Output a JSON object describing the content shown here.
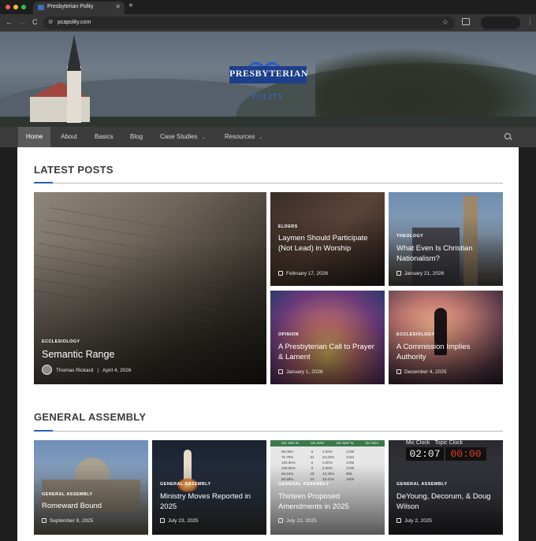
{
  "browser": {
    "tab_title": "Presbyterian Polity",
    "tab_close": "✕",
    "new_tab": "+",
    "url": "pcapolity.com",
    "back": "←",
    "forward": "→",
    "reload": "C",
    "site_info": "⚙",
    "star": "☆",
    "menu": "⋮"
  },
  "logo": {
    "line1": "PRESBYTERIAN",
    "line2": "POLITY"
  },
  "nav": {
    "items": [
      {
        "label": "Home"
      },
      {
        "label": "About"
      },
      {
        "label": "Basics"
      },
      {
        "label": "Blog"
      },
      {
        "label": "Case Studies"
      },
      {
        "label": "Resources"
      }
    ],
    "caret": "⌄"
  },
  "latest": {
    "title": "LATEST POSTS",
    "feature": {
      "category": "ECCLESIOLOGY",
      "title": "Semantic Range",
      "author": "Thomas Rickard",
      "sep": "|",
      "date": "April 4, 2026"
    },
    "posts": [
      {
        "category": "ELDERS",
        "title": "Laymen Should Participate (Not Lead) in Worship",
        "date": "February 17, 2026"
      },
      {
        "category": "THEOLOGY",
        "title": "What Even Is Christian Nationalism?",
        "date": "January 21, 2026"
      },
      {
        "category": "OPINION",
        "title": "A Presbyterian Call to Prayer & Lament",
        "date": "January 1, 2026"
      },
      {
        "category": "ECCLESIOLOGY",
        "title": "A Commission Implies Authority",
        "date": "December 4, 2025"
      }
    ]
  },
  "assembly": {
    "title": "GENERAL ASSEMBLY",
    "posts": [
      {
        "category": "GENERAL ASSEMBLY",
        "title": "Romeward Bound",
        "date": "September 8, 2025"
      },
      {
        "category": "GENERAL ASSEMBLY",
        "title": "Ministry Moves Reported in 2025",
        "date": "July 23, 2025"
      },
      {
        "category": "GENERAL ASSEMBLY",
        "title": "Thirteen Proposed Amendments in 2025",
        "date": "July 22, 2025"
      },
      {
        "category": "GENERAL ASSEMBLY",
        "title": "DeYoung, Decorum, & Doug Wilson",
        "date": "July 2, 2025"
      }
    ],
    "clock": {
      "mic_label": "Mic Clock",
      "topic_label": "Topic Clock",
      "mic_time": "02:07",
      "topic_time": "00:00"
    },
    "vote_table": {
      "headers": [
        "OC YEA %",
        "OC NAY",
        "OC NAY %",
        "GA YEA"
      ],
      "rows": [
        [
          "95.08%",
          "6",
          "4.92%",
          "1708"
        ],
        [
          "75.78%",
          "31",
          "24.22%",
          "1443"
        ],
        [
          "100.00%",
          "0",
          "0.00%",
          "1708"
        ],
        [
          "100.00%",
          "0",
          "0.00%",
          "1708"
        ],
        [
          "56.64%",
          "49",
          "43.36%",
          "905"
        ],
        [
          "80.59%",
          "14",
          "15.41%",
          "1506"
        ]
      ]
    }
  },
  "colors": {
    "accent": "#2760b8",
    "nav_bg": "#3c3c3c",
    "logo_blue": "#1d3f8a"
  }
}
